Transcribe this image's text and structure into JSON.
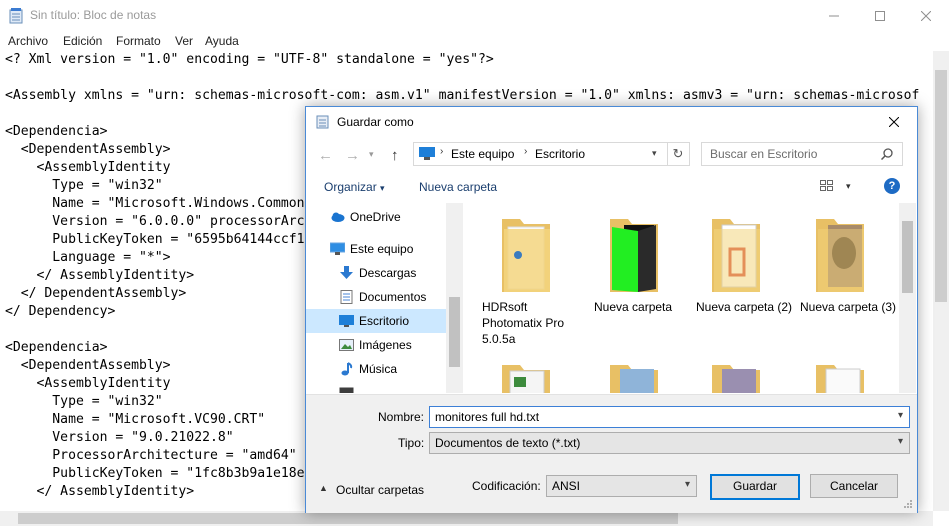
{
  "notepad": {
    "title": "Sin título: Bloc de notas",
    "menu": [
      "Archivo",
      "Edición",
      "Formato",
      "Ver",
      "Ayuda"
    ],
    "lines": [
      "<? Xml version = \"1.0\" encoding = \"UTF-8\" standalone = \"yes\"?>",
      "",
      "<Assembly xmlns = \"urn: schemas-microsoft-com: asm.v1\" manifestVersion = \"1.0\" xmlns: asmv3 = \"urn: schemas-microsof",
      "",
      "<Dependencia>",
      "  <DependentAssembly>",
      "    <AssemblyIdentity",
      "      Type = \"win32\"",
      "      Name = \"Microsoft.Windows.Common",
      "      Version = \"6.0.0.0\" processorArc",
      "      PublicKeyToken = \"6595b64144ccf1",
      "      Language = \"*\">",
      "    </ AssemblyIdentity>",
      "  </ DependentAssembly>",
      "</ Dependency>",
      "",
      "<Dependencia>",
      "  <DependentAssembly>",
      "    <AssemblyIdentity",
      "      Type = \"win32\"",
      "      Name = \"Microsoft.VC90.CRT\"",
      "      Version = \"9.0.21022.8\"",
      "      ProcessorArchitecture = \"amd64\"",
      "      PublicKeyToken = \"1fc8b3b9a1e18e",
      "    </ AssemblyIdentity>"
    ]
  },
  "dialog": {
    "title": "Guardar como",
    "breadcrumb": [
      "Este equipo",
      "Escritorio"
    ],
    "search_placeholder": "Buscar en Escritorio",
    "organize_label": "Organizar",
    "new_folder_label": "Nueva carpeta",
    "nav_items": [
      {
        "label": "OneDrive",
        "icon": "cloud-icon"
      },
      {
        "label": "Este equipo",
        "icon": "computer-icon"
      },
      {
        "label": "Descargas",
        "icon": "download-icon"
      },
      {
        "label": "Documentos",
        "icon": "document-icon"
      },
      {
        "label": "Escritorio",
        "icon": "desktop-icon",
        "selected": true
      },
      {
        "label": "Imágenes",
        "icon": "pictures-icon"
      },
      {
        "label": "Música",
        "icon": "music-icon"
      }
    ],
    "files": [
      {
        "label": "HDRsoft Photomatix Pro 5.0.5a"
      },
      {
        "label": "Nueva carpeta"
      },
      {
        "label": "Nueva carpeta (2)"
      },
      {
        "label": "Nueva carpeta (3)"
      }
    ],
    "filename_label": "Nombre:",
    "filename_value": "monitores full hd.txt",
    "type_label": "Tipo:",
    "type_value": "Documentos de texto (*.txt)",
    "hide_folders_label": "Ocultar carpetas",
    "encoding_label": "Codificación:",
    "encoding_value": "ANSI",
    "save_label": "Guardar",
    "cancel_label": "Cancelar"
  }
}
